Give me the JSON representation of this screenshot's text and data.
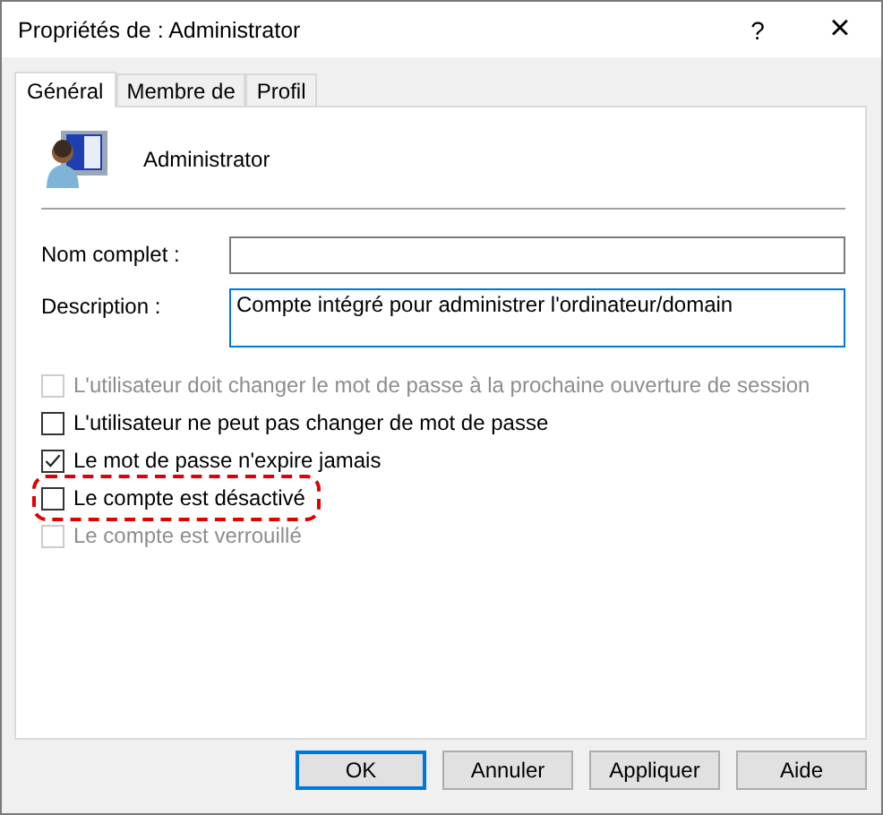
{
  "window": {
    "title": "Propriétés de : Administrator",
    "help": "?",
    "close": "×"
  },
  "tabs": [
    {
      "label": "Général",
      "selected": true
    },
    {
      "label": "Membre de",
      "selected": false
    },
    {
      "label": "Profil",
      "selected": false
    }
  ],
  "user": {
    "name": "Administrator"
  },
  "fields": [
    {
      "label": "Nom complet :",
      "focused": false
    },
    {
      "label": "Description :",
      "value": "Compte intégré pour administrer l'ordinateur/domain",
      "focused": true
    }
  ],
  "checks": [
    {
      "label": "L'utilisateur doit changer le mot de passe à la prochaine ouverture de session",
      "checked": false,
      "disabled": true,
      "highlighted": false
    },
    {
      "label": "L'utilisateur ne peut pas changer de mot de passe",
      "checked": false,
      "disabled": false,
      "highlighted": false
    },
    {
      "label": "Le mot de passe n'expire jamais",
      "checked": true,
      "disabled": false,
      "highlighted": false
    },
    {
      "label": "Le compte est désactivé",
      "checked": false,
      "disabled": false,
      "highlighted": true
    },
    {
      "label": "Le compte est verrouillé",
      "checked": false,
      "disabled": true,
      "highlighted": false
    }
  ],
  "buttons": [
    {
      "label": "OK",
      "default": true
    },
    {
      "label": "Annuler",
      "default": false
    },
    {
      "label": "Appliquer",
      "default": false
    },
    {
      "label": "Aide",
      "default": false
    }
  ]
}
